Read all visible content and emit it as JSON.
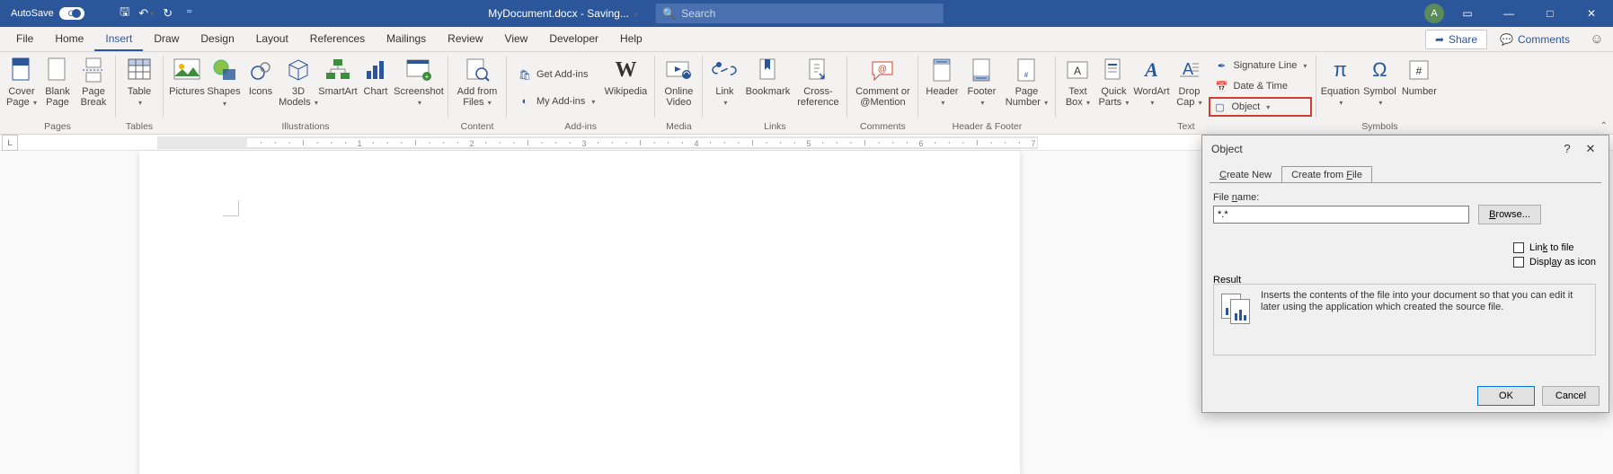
{
  "titlebar": {
    "autosave": "AutoSave",
    "autosave_state": "On",
    "doc_title": "MyDocument.docx  -  Saving...",
    "search_placeholder": "Search",
    "avatar_initial": "A"
  },
  "tabs": {
    "file": "File",
    "home": "Home",
    "insert": "Insert",
    "draw": "Draw",
    "design": "Design",
    "layout": "Layout",
    "references": "References",
    "mailings": "Mailings",
    "review": "Review",
    "view": "View",
    "developer": "Developer",
    "help": "Help",
    "share": "Share",
    "comments": "Comments"
  },
  "ribbon": {
    "pages": {
      "label": "Pages",
      "cover": "Cover Page",
      "blank": "Blank Page",
      "break": "Page Break"
    },
    "tables": {
      "label": "Tables",
      "table": "Table"
    },
    "illustrations": {
      "label": "Illustrations",
      "pictures": "Pictures",
      "shapes": "Shapes",
      "icons": "Icons",
      "models": "3D Models",
      "smartart": "SmartArt",
      "chart": "Chart",
      "screenshot": "Screenshot"
    },
    "content": {
      "label": "Content",
      "addfrom": "Add from Files"
    },
    "addins": {
      "label": "Add-ins",
      "get": "Get Add-ins",
      "my": "My Add-ins",
      "wikipedia": "Wikipedia"
    },
    "media": {
      "label": "Media",
      "video": "Online Video"
    },
    "links": {
      "label": "Links",
      "link": "Link",
      "bookmark": "Bookmark",
      "crossref": "Cross-reference"
    },
    "comments": {
      "label": "Comments",
      "comment": "Comment or @Mention"
    },
    "headerfooter": {
      "label": "Header & Footer",
      "header": "Header",
      "footer": "Footer",
      "pagenum": "Page Number"
    },
    "text": {
      "label": "Text",
      "textbox": "Text Box",
      "quick": "Quick Parts",
      "wordart": "WordArt",
      "dropcap": "Drop Cap",
      "sig": "Signature Line",
      "date": "Date & Time",
      "object": "Object"
    },
    "symbols": {
      "label": "Symbols",
      "equation": "Equation",
      "symbol": "Symbol",
      "number": "Number"
    }
  },
  "ruler": {
    "marks": [
      "1",
      "2",
      "3",
      "4",
      "5",
      "6",
      "7"
    ]
  },
  "dialog": {
    "title": "Object",
    "tab_new": "Create New",
    "tab_file": "Create from File",
    "file_label": "File name:",
    "file_value": "*.*",
    "browse": "Browse...",
    "link": "Link to file",
    "display_icon": "Display as icon",
    "result_label": "Result",
    "result_text": "Inserts the contents of the file into your document so that you can edit it later using the application which created the source file.",
    "ok": "OK",
    "cancel": "Cancel"
  }
}
